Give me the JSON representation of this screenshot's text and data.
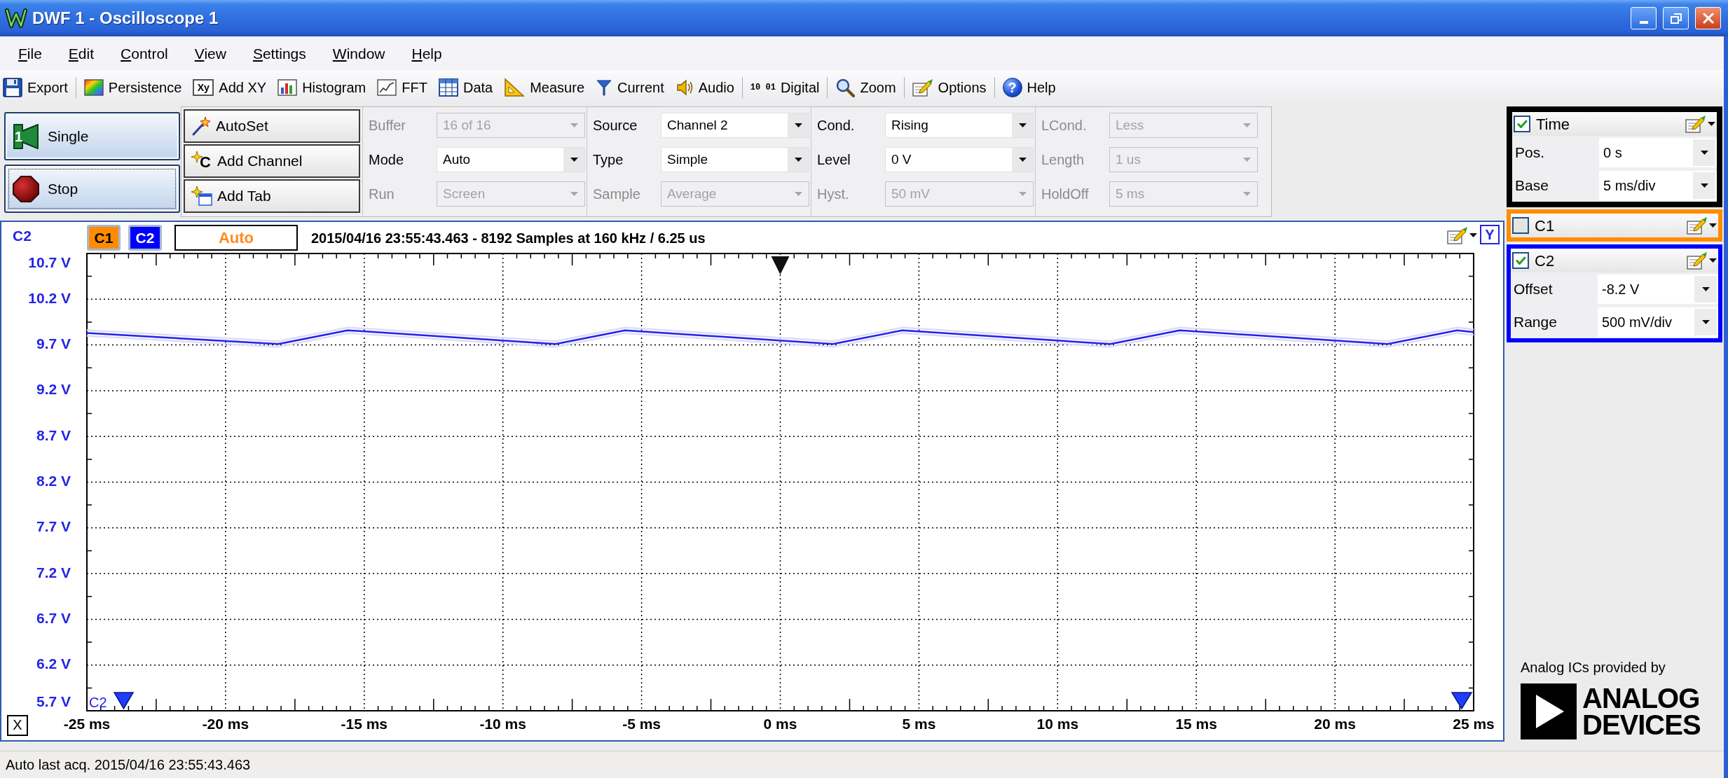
{
  "window": {
    "title": "DWF 1 - Oscilloscope 1"
  },
  "menu": [
    "File",
    "Edit",
    "Control",
    "View",
    "Settings",
    "Window",
    "Help"
  ],
  "toolbar": [
    [
      {
        "label": "Export",
        "kind": "export"
      }
    ],
    [
      {
        "label": "Persistence",
        "kind": "persistence"
      },
      {
        "label": "Add XY",
        "kind": "xy",
        "icon_text": "Xy"
      },
      {
        "label": "Histogram",
        "kind": "histogram"
      },
      {
        "label": "FFT",
        "kind": "fft"
      },
      {
        "label": "Data",
        "kind": "data"
      },
      {
        "label": "Measure",
        "kind": "measure"
      },
      {
        "label": "Current",
        "kind": "current"
      },
      {
        "label": "Audio",
        "kind": "audio"
      }
    ],
    [
      {
        "label": "Digital",
        "kind": "digital",
        "icon_text": "10 01"
      }
    ],
    [
      {
        "label": "Zoom",
        "kind": "zoom"
      }
    ],
    [
      {
        "label": "Options",
        "kind": "options"
      }
    ],
    [
      {
        "label": "Help",
        "kind": "help",
        "icon_text": "?"
      }
    ]
  ],
  "acquire": [
    {
      "label": "Single",
      "kind": "single",
      "icon_text": "1",
      "focused": false
    },
    {
      "label": "Stop",
      "kind": "stop",
      "focused": true
    }
  ],
  "actions": [
    {
      "label": "AutoSet",
      "kind": "autoset"
    },
    {
      "label": "Add Channel",
      "kind": "add_channel",
      "icon_text": "C"
    },
    {
      "label": "Add Tab",
      "kind": "add_tab"
    }
  ],
  "trigger_settings": [
    [
      {
        "label": "Buffer",
        "value": "16 of 16",
        "disabled": true
      },
      {
        "label": "Mode",
        "value": "Auto",
        "disabled": false
      },
      {
        "label": "Run",
        "value": "Screen",
        "disabled": true
      }
    ],
    [
      {
        "label": "Source",
        "value": "Channel 2",
        "disabled": false
      },
      {
        "label": "Type",
        "value": "Simple",
        "disabled": false
      },
      {
        "label": "Sample",
        "value": "Average",
        "disabled": true
      }
    ],
    [
      {
        "label": "Cond.",
        "value": "Rising",
        "disabled": false
      },
      {
        "label": "Level",
        "value": "0 V",
        "disabled": false
      },
      {
        "label": "Hyst.",
        "value": "50 mV",
        "disabled": true
      }
    ],
    [
      {
        "label": "LCond.",
        "value": "Less",
        "disabled": true
      },
      {
        "label": "Length",
        "value": "1 us",
        "disabled": true
      },
      {
        "label": "HoldOff",
        "value": "5 ms",
        "disabled": true
      }
    ]
  ],
  "plot": {
    "channel_tabs": [
      {
        "label": "C1",
        "color": "#ff8c00"
      },
      {
        "label": "C2",
        "color": "#0000ff"
      }
    ],
    "trigger_status": "Auto",
    "acquisition_info": "2015/04/16 23:55:43.463 - 8192 Samples at 160 kHz / 6.25 us",
    "y_button": "Y",
    "x_button": "X",
    "chart_data": {
      "type": "line",
      "ylabel": "C2",
      "grid": true,
      "x": [
        -25,
        -18.1,
        -15.6,
        -8.1,
        -5.6,
        1.9,
        4.4,
        11.9,
        14.4,
        21.9,
        24.4,
        25
      ],
      "series": [
        {
          "name": "C2",
          "color": "#2424e8",
          "values": [
            9.83,
            9.71,
            9.86,
            9.71,
            9.86,
            9.71,
            9.86,
            9.71,
            9.86,
            9.71,
            9.86,
            9.84
          ]
        }
      ],
      "xlim": [
        -25,
        25
      ],
      "ylim": [
        5.7,
        10.7
      ],
      "xticks": [
        {
          "value": -25,
          "label": "-25 ms"
        },
        {
          "value": -20,
          "label": "-20 ms"
        },
        {
          "value": -15,
          "label": "-15 ms"
        },
        {
          "value": -10,
          "label": "-10 ms"
        },
        {
          "value": -5,
          "label": "-5 ms"
        },
        {
          "value": 0,
          "label": "0 ms"
        },
        {
          "value": 5,
          "label": "5 ms"
        },
        {
          "value": 10,
          "label": "10 ms"
        },
        {
          "value": 15,
          "label": "15 ms"
        },
        {
          "value": 20,
          "label": "20 ms"
        },
        {
          "value": 25,
          "label": "25 ms"
        }
      ],
      "yticks": [
        {
          "value": 10.7,
          "label": "10.7 V"
        },
        {
          "value": 10.2,
          "label": "10.2 V"
        },
        {
          "value": 9.7,
          "label": "9.7 V"
        },
        {
          "value": 9.2,
          "label": "9.2 V"
        },
        {
          "value": 8.7,
          "label": "8.7 V"
        },
        {
          "value": 8.2,
          "label": "8.2 V"
        },
        {
          "value": 7.7,
          "label": "7.7 V"
        },
        {
          "value": 7.2,
          "label": "7.2 V"
        },
        {
          "value": 6.7,
          "label": "6.7 V"
        },
        {
          "value": 6.2,
          "label": "6.2 V"
        },
        {
          "value": 5.7,
          "label": "5.7 V"
        }
      ]
    }
  },
  "channel_panels": [
    {
      "title": "Time",
      "checked": true,
      "color": "#000000",
      "fields": [
        {
          "label": "Pos.",
          "value": "0 s"
        },
        {
          "label": "Base",
          "value": "5 ms/div"
        }
      ]
    },
    {
      "title": "C1",
      "checked": false,
      "color": "#ff8c00"
    },
    {
      "title": "C2",
      "checked": true,
      "color": "#0000ff",
      "fields": [
        {
          "label": "Offset",
          "value": "-8.2 V"
        },
        {
          "label": "Range",
          "value": "500 mV/div"
        }
      ]
    }
  ],
  "branding": {
    "caption": "Analog ICs provided by",
    "wordmark": "ANALOG DEVICES"
  },
  "status_bar": "Auto last acq. 2015/04/16 23:55:43.463"
}
